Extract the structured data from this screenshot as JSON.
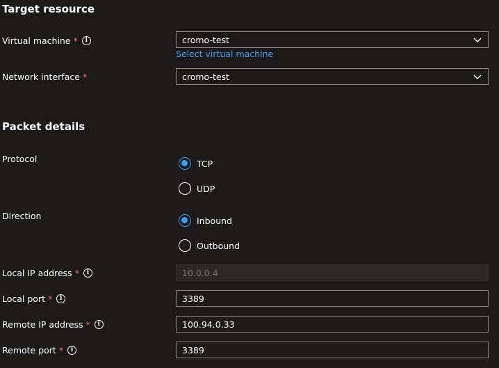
{
  "target_resource": {
    "title": "Target resource",
    "virtual_machine": {
      "label": "Virtual machine",
      "required_marker": "*",
      "value": "cromo-test",
      "link": "Select virtual machine"
    },
    "network_interface": {
      "label": "Network interface",
      "required_marker": "*",
      "value": "cromo-test"
    }
  },
  "packet_details": {
    "title": "Packet details",
    "protocol": {
      "label": "Protocol",
      "options": [
        "TCP",
        "UDP"
      ],
      "selected": "TCP"
    },
    "direction": {
      "label": "Direction",
      "options": [
        "Inbound",
        "Outbound"
      ],
      "selected": "Inbound"
    },
    "local_ip": {
      "label": "Local IP address",
      "required_marker": "*",
      "value": "10.0.0.4"
    },
    "local_port": {
      "label": "Local port",
      "required_marker": "*",
      "value": "3389"
    },
    "remote_ip": {
      "label": "Remote IP address",
      "required_marker": "*",
      "value": "100.94.0.33"
    },
    "remote_port": {
      "label": "Remote port",
      "required_marker": "*",
      "value": "3389"
    }
  },
  "info_icon_glyph": "i",
  "colors": {
    "accent": "#3aa0f3",
    "required": "#f1707b",
    "background": "#1b1a19"
  }
}
